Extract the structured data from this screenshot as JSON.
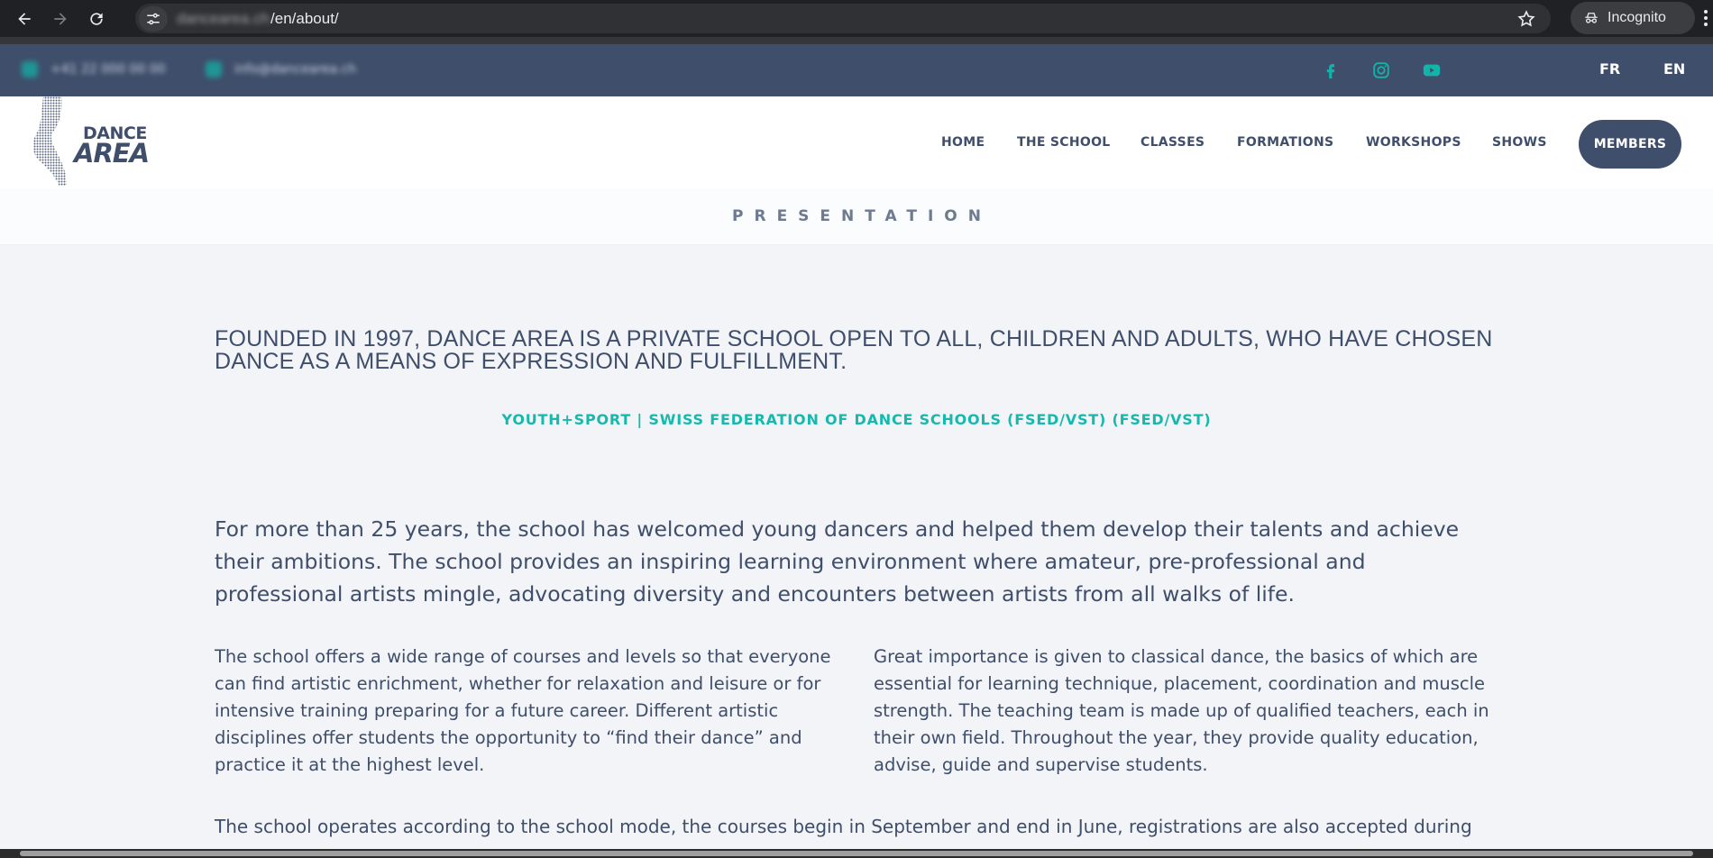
{
  "browser": {
    "url_host": "dancearea.ch",
    "url_path": "/en/about/",
    "incognito_label": "Incognito"
  },
  "infobar": {
    "phone": "+41 22 000 00 00",
    "email": "info@dancearea.ch",
    "lang_fr": "FR",
    "lang_en": "EN",
    "social_icons": [
      "facebook-icon",
      "instagram-icon",
      "youtube-icon"
    ],
    "accent_color": "#12b3a8",
    "bar_color": "#3f4e6b"
  },
  "header": {
    "logo_line1": "DANCE",
    "logo_line2": "AREA",
    "menu": [
      "HOME",
      "THE SCHOOL",
      "CLASSES",
      "FORMATIONS",
      "WORKSHOPS",
      "SHOWS"
    ],
    "members_label": "MEMBERS"
  },
  "presentation": {
    "title": "PRESENTATION"
  },
  "main": {
    "headline": "FOUNDED IN 1997, DANCE AREA IS A PRIVATE SCHOOL OPEN TO ALL, CHILDREN AND ADULTS, WHO HAVE CHOSEN DANCE AS A MEANS OF EXPRESSION AND FULFILLMENT.",
    "affiliation": "YOUTH+SPORT | SWISS FEDERATION OF DANCE SCHOOLS (FSED/VST) (FSED/VST)",
    "lead": "For more than 25 years, the school has welcomed young dancers and helped them develop their talents and achieve their ambitions. The school provides an inspiring learning environment where amateur, pre-professional and professional artists mingle, advocating diversity and encounters between artists from all walks of life.",
    "col_left": "The school offers a wide range of courses and levels so that everyone can find artistic enrichment, whether for relaxation and leisure or for intensive training preparing for a future career. Different artistic disciplines offer students the opportunity to “find their dance” and practice it at the highest level.",
    "col_right": "Great importance is given to classical dance, the basics of which are essential for learning technique, placement, coordination and muscle strength. The teaching team is made up of qualified teachers, each in their own field. Throughout the year, they provide quality education, advise, guide and supervise students.",
    "para3": "The school operates according to the school mode, the courses begin in September and end in June, registrations are also accepted during"
  }
}
